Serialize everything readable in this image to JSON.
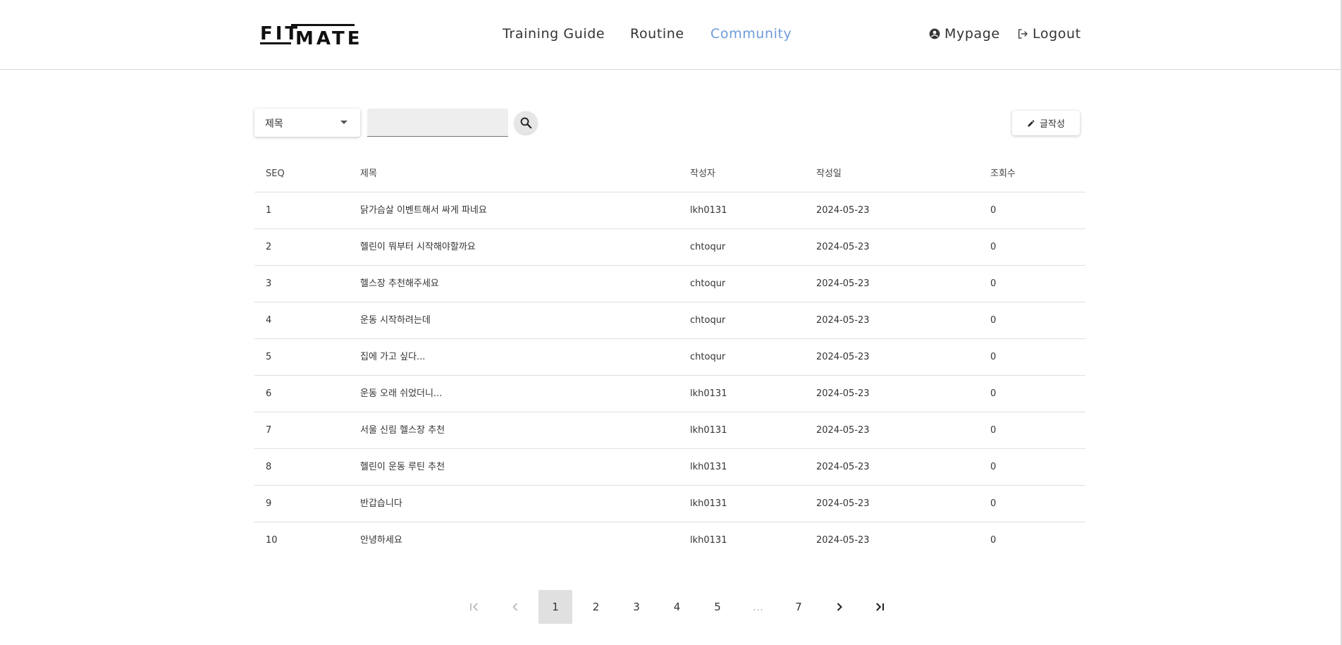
{
  "header": {
    "logo_top": "FIT",
    "logo_bottom": "MATE",
    "nav": [
      {
        "label": "Training Guide",
        "active": false
      },
      {
        "label": "Routine",
        "active": false
      },
      {
        "label": "Community",
        "active": true
      }
    ],
    "mypage_label": "Mypage",
    "logout_label": "Logout",
    "active_color": "#6e9ad8"
  },
  "toolbar": {
    "search_field": "제목",
    "search_value": "",
    "write_label": "글작성"
  },
  "table": {
    "columns": [
      "SEQ",
      "제목",
      "작성자",
      "작성일",
      "조회수"
    ],
    "rows": [
      {
        "seq": "1",
        "title": "닭가슴살 이벤트해서 싸게 파네요",
        "author": "lkh0131",
        "date": "2024-05-23",
        "views": "0"
      },
      {
        "seq": "2",
        "title": "헬린이 뭐부터 시작해야할까요",
        "author": "chtoqur",
        "date": "2024-05-23",
        "views": "0"
      },
      {
        "seq": "3",
        "title": "헬스장 추천해주세요",
        "author": "chtoqur",
        "date": "2024-05-23",
        "views": "0"
      },
      {
        "seq": "4",
        "title": "운동 시작하려는데",
        "author": "chtoqur",
        "date": "2024-05-23",
        "views": "0"
      },
      {
        "seq": "5",
        "title": "집에 가고 싶다...",
        "author": "chtoqur",
        "date": "2024-05-23",
        "views": "0"
      },
      {
        "seq": "6",
        "title": "운동 오래 쉬었더니...",
        "author": "lkh0131",
        "date": "2024-05-23",
        "views": "0"
      },
      {
        "seq": "7",
        "title": "서울 신림 헬스장 추천",
        "author": "lkh0131",
        "date": "2024-05-23",
        "views": "0"
      },
      {
        "seq": "8",
        "title": "헬린이 운동 루틴 추천",
        "author": "lkh0131",
        "date": "2024-05-23",
        "views": "0"
      },
      {
        "seq": "9",
        "title": "반갑습니다",
        "author": "lkh0131",
        "date": "2024-05-23",
        "views": "0"
      },
      {
        "seq": "10",
        "title": "안녕하세요",
        "author": "lkh0131",
        "date": "2024-05-23",
        "views": "0"
      }
    ]
  },
  "pagination": {
    "current": "1",
    "pages": [
      "1",
      "2",
      "3",
      "4",
      "5",
      "…",
      "7"
    ],
    "icons": [
      "first-page-icon",
      "prev-page-icon",
      "next-page-icon",
      "last-page-icon"
    ]
  }
}
